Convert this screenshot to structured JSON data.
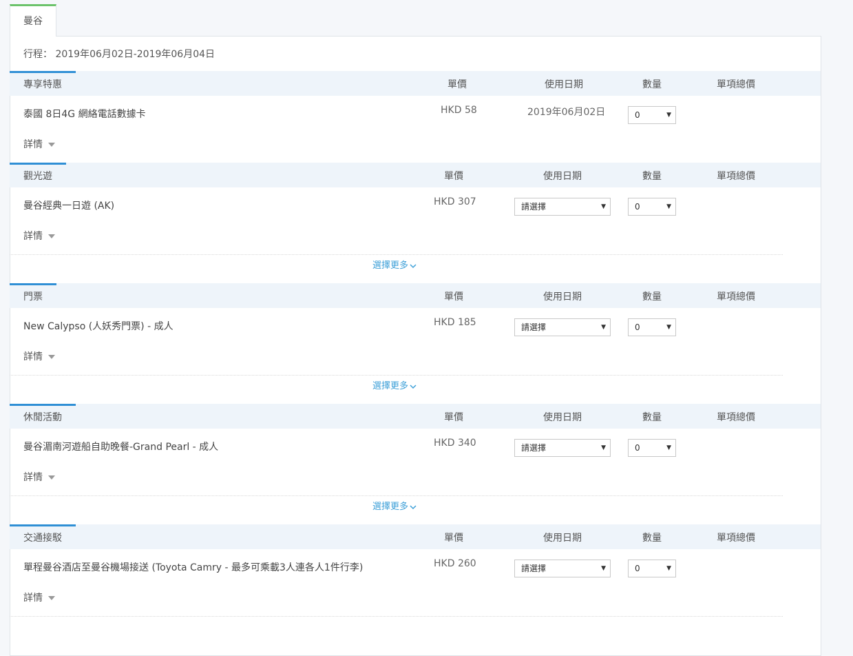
{
  "tab": {
    "label": "曼谷"
  },
  "trip": {
    "label": "行程：",
    "dates": "2019年06月02日-2019年06月04日"
  },
  "columns": {
    "unit_price": "單價",
    "use_date": "使用日期",
    "quantity": "數量",
    "item_total": "單項總價"
  },
  "details_label": "詳情",
  "more_label": "選擇更多",
  "sections": [
    {
      "title": "專享特惠",
      "item": "泰國 8日4G 網絡電話數據卡",
      "price": "HKD 58",
      "use_date": "2019年06月02日",
      "quantity": "0"
    },
    {
      "title": "觀光遊",
      "item": "曼谷經典一日遊 (AK)",
      "price": "HKD 307",
      "date_select": "請選擇",
      "quantity": "0"
    },
    {
      "title": "門票",
      "item": "New Calypso (人妖秀門票) - 成人",
      "price": "HKD 185",
      "date_select": "請選擇",
      "quantity": "0"
    },
    {
      "title": "休閒活動",
      "item": "曼谷湄南河遊船自助晚餐-Grand Pearl - 成人",
      "price": "HKD 340",
      "date_select": "請選擇",
      "quantity": "0"
    },
    {
      "title": "交通接駁",
      "item": "單程曼谷酒店至曼谷機場接送 (Toyota Camry - 最多可乘載3人連各人1件行李)",
      "price": "HKD 260",
      "date_select": "請選擇",
      "quantity": "0"
    }
  ],
  "colors": {
    "tab_accent": "#6cc36b",
    "section_accent": "#2f8fd5",
    "link": "#3ea0d8",
    "header_bg": "#eef4fa"
  }
}
